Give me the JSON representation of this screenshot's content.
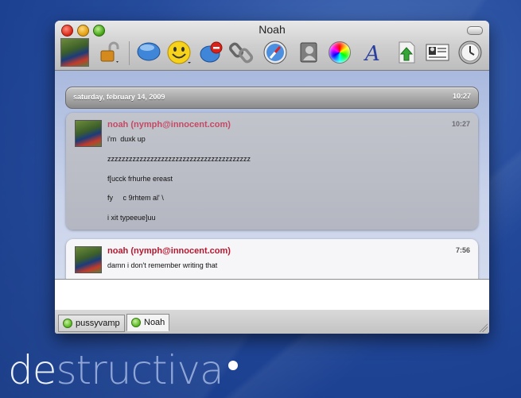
{
  "desktop": {
    "brand_dark": "de",
    "brand_light": "structiva"
  },
  "window": {
    "title": "Noah"
  },
  "toolbar": {
    "icons": [
      "buddy-picture",
      "lock-icon",
      "message-bubble-icon",
      "smiley-icon",
      "block-icon",
      "link-icon",
      "safari-icon",
      "address-book-icon",
      "color-wheel-icon",
      "font-icon",
      "send-file-icon",
      "contact-card-icon",
      "clock-icon"
    ]
  },
  "chat": {
    "date": "saturday, february 14, 2009",
    "date_time": "10:27",
    "messages": [
      {
        "sender": "noah (nymph@innocent.com)",
        "time": "10:27",
        "lines": [
          "i'm  duxk up",
          "zzzzzzzzzzzzzzzzzzzzzzzzzzzzzzzzzzzzzzzz",
          "f[ucck frhurhe ereast",
          "fy     c 9rhtem al' \\",
          "i xit typeeue]uu"
        ]
      },
      {
        "sender": "noah (nymph@innocent.com)",
        "time": "7:56",
        "lines": [
          "damn i don't remember writing that"
        ]
      }
    ]
  },
  "input": {
    "value": ""
  },
  "tabs": [
    {
      "label": "pussyvamp",
      "active": false
    },
    {
      "label": "Noah",
      "active": true
    }
  ]
}
